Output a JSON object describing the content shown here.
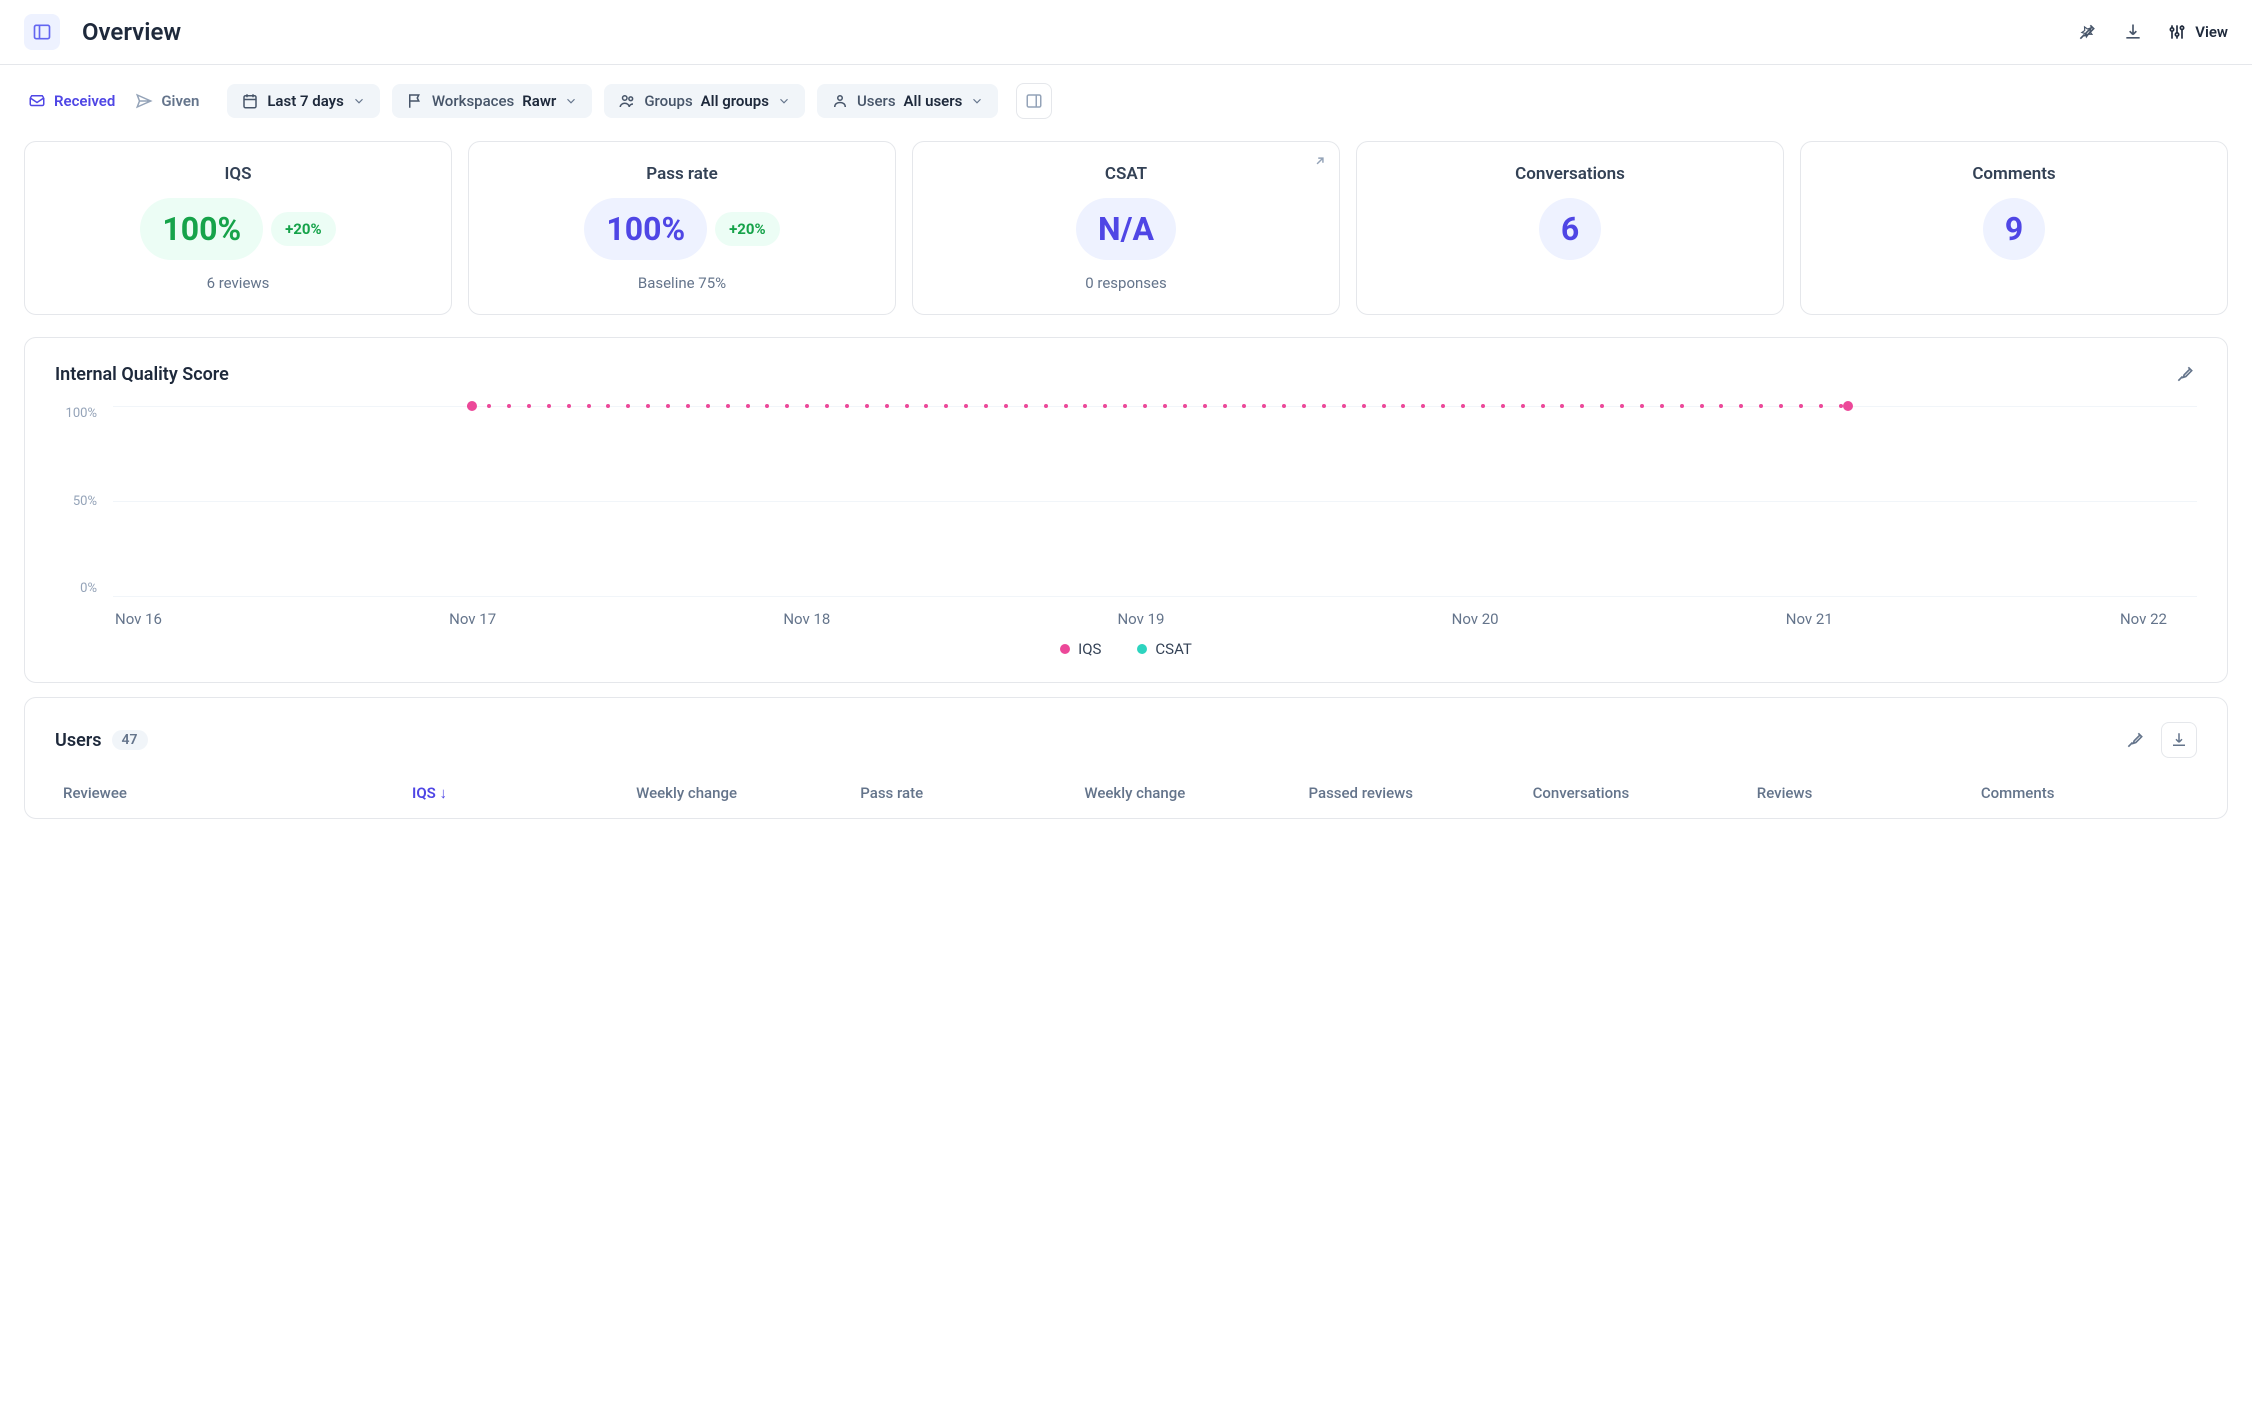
{
  "header": {
    "title": "Overview",
    "view_label": "View"
  },
  "tabs": {
    "received": "Received",
    "given": "Given"
  },
  "filters": {
    "date": {
      "label": "Last 7 days"
    },
    "workspaces": {
      "label": "Workspaces",
      "value": "Rawr"
    },
    "groups": {
      "label": "Groups",
      "value": "All groups"
    },
    "users": {
      "label": "Users",
      "value": "All users"
    }
  },
  "cards": {
    "iqs": {
      "title": "IQS",
      "value": "100%",
      "delta": "+20%",
      "sub": "6 reviews"
    },
    "pass_rate": {
      "title": "Pass rate",
      "value": "100%",
      "delta": "+20%",
      "sub": "Baseline 75%"
    },
    "csat": {
      "title": "CSAT",
      "value": "N/A",
      "sub": "0 responses"
    },
    "conversations": {
      "title": "Conversations",
      "value": "6"
    },
    "comments": {
      "title": "Comments",
      "value": "9"
    }
  },
  "chart": {
    "title": "Internal Quality Score",
    "y_ticks": [
      "100%",
      "50%",
      "0%"
    ],
    "x_ticks": [
      "Nov 16",
      "Nov 17",
      "Nov 18",
      "Nov 19",
      "Nov 20",
      "Nov 21",
      "Nov 22"
    ],
    "legend": {
      "iqs": "IQS",
      "csat": "CSAT"
    },
    "colors": {
      "iqs": "#ec4899",
      "csat": "#2dd4bf"
    }
  },
  "chart_data": {
    "type": "line",
    "title": "Internal Quality Score",
    "xlabel": "",
    "ylabel": "",
    "ylim": [
      0,
      100
    ],
    "categories": [
      "Nov 16",
      "Nov 17",
      "Nov 18",
      "Nov 19",
      "Nov 20",
      "Nov 21",
      "Nov 22"
    ],
    "series": [
      {
        "name": "IQS",
        "values": [
          null,
          100,
          100,
          100,
          100,
          100,
          null
        ]
      },
      {
        "name": "CSAT",
        "values": [
          null,
          null,
          null,
          null,
          null,
          null,
          null
        ]
      }
    ]
  },
  "users_panel": {
    "title": "Users",
    "count": "47",
    "columns": {
      "reviewee": "Reviewee",
      "iqs": "IQS",
      "weekly_change_1": "Weekly change",
      "pass_rate": "Pass rate",
      "weekly_change_2": "Weekly change",
      "passed_reviews": "Passed reviews",
      "conversations": "Conversations",
      "reviews": "Reviews",
      "comments": "Comments"
    },
    "sort_arrow": "↓"
  }
}
